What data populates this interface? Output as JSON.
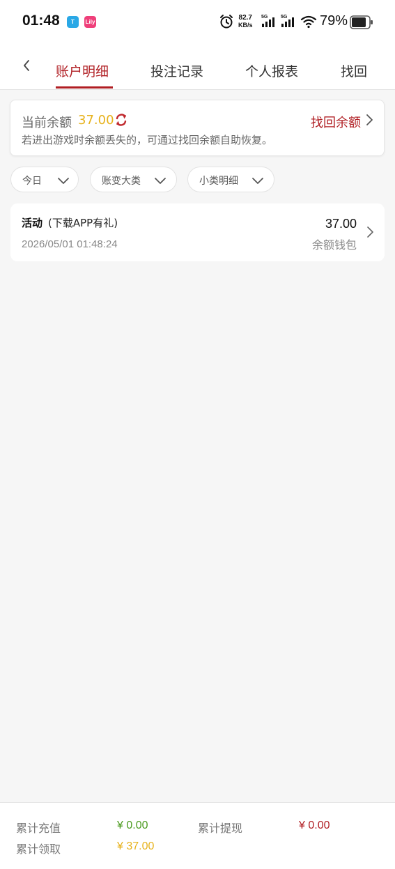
{
  "status_bar": {
    "time": "01:48",
    "app1": "T",
    "app2": "Lily",
    "speed_value": "82.7",
    "speed_unit": "KB/s",
    "net1": "5G",
    "net2": "5G",
    "battery": "79%"
  },
  "tabs": [
    {
      "label": "账户明细"
    },
    {
      "label": "投注记录"
    },
    {
      "label": "个人报表"
    },
    {
      "label": "找回"
    }
  ],
  "balance": {
    "label": "当前余额",
    "value": "37.00",
    "recover_label": "找回余额",
    "hint": "若进出游戏时余额丢失的，可通过找回余额自助恢复。"
  },
  "filters": [
    {
      "label": "今日"
    },
    {
      "label": "账变大类"
    },
    {
      "label": "小类明细"
    }
  ],
  "records": [
    {
      "title": "活动",
      "subtitle": "(下载APP有礼)",
      "time": "2026/05/01 01:48:24",
      "amount": "37.00",
      "wallet": "余额钱包"
    }
  ],
  "summary": {
    "recharge_label": "累计充值",
    "recharge_value": "¥ 0.00",
    "withdraw_label": "累计提现",
    "withdraw_value": "¥ 0.00",
    "claim_label": "累计领取",
    "claim_value": "¥ 37.00"
  },
  "colors": {
    "accent": "#b01e23",
    "gold": "#e7b21c",
    "green": "#4a9a1d"
  },
  "icons": [
    "back-icon",
    "refresh-icon",
    "chevron-right-icon",
    "chevron-down-icon",
    "alarm-icon",
    "signal-icon",
    "wifi-icon",
    "battery-icon"
  ]
}
